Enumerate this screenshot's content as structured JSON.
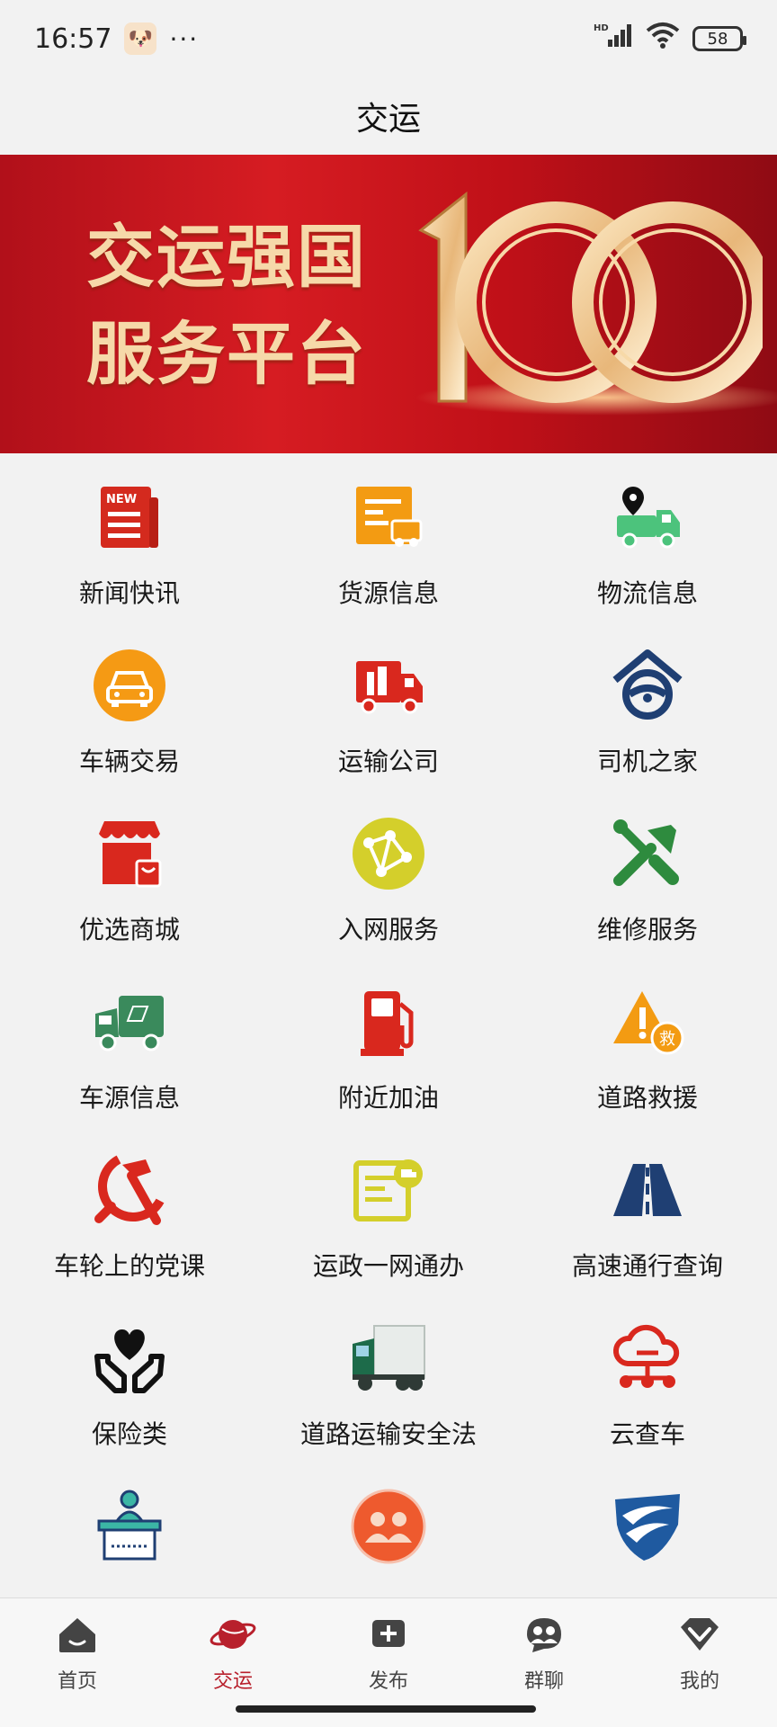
{
  "status": {
    "time": "16:57",
    "dots": "···",
    "network": "HD",
    "battery": "58"
  },
  "header": {
    "title": "交运"
  },
  "banner": {
    "title_line1": "交运强国",
    "title_line2": "服务平台",
    "number": "100"
  },
  "services": [
    {
      "label": "新闻快讯",
      "icon": "news-icon"
    },
    {
      "label": "货源信息",
      "icon": "cargo-source-icon"
    },
    {
      "label": "物流信息",
      "icon": "logistics-truck-icon"
    },
    {
      "label": "车辆交易",
      "icon": "car-trade-icon"
    },
    {
      "label": "运输公司",
      "icon": "transport-company-icon"
    },
    {
      "label": "司机之家",
      "icon": "driver-home-icon"
    },
    {
      "label": "优选商城",
      "icon": "store-icon"
    },
    {
      "label": "入网服务",
      "icon": "network-service-icon"
    },
    {
      "label": "维修服务",
      "icon": "repair-tools-icon"
    },
    {
      "label": "车源信息",
      "icon": "vehicle-source-icon"
    },
    {
      "label": "附近加油",
      "icon": "fuel-pump-icon"
    },
    {
      "label": "道路救援",
      "icon": "road-rescue-icon"
    },
    {
      "label": "车轮上的党课",
      "icon": "party-emblem-icon"
    },
    {
      "label": "运政一网通办",
      "icon": "gov-service-icon"
    },
    {
      "label": "高速通行查询",
      "icon": "highway-icon"
    },
    {
      "label": "保险类",
      "icon": "insurance-hands-icon"
    },
    {
      "label": "道路运输安全法",
      "icon": "truck-photo-icon"
    },
    {
      "label": "云查车",
      "icon": "cloud-check-icon"
    },
    {
      "label": "",
      "icon": "podium-icon"
    },
    {
      "label": "",
      "icon": "meeting-icon"
    },
    {
      "label": "",
      "icon": "shield-logo-icon"
    }
  ],
  "rescue_badge": "救",
  "tabs": [
    {
      "label": "首页",
      "icon": "home-icon"
    },
    {
      "label": "交运",
      "icon": "planet-icon"
    },
    {
      "label": "发布",
      "icon": "publish-icon"
    },
    {
      "label": "群聊",
      "icon": "group-chat-icon"
    },
    {
      "label": "我的",
      "icon": "profile-icon"
    }
  ],
  "colors": {
    "accent": "#b8202c",
    "banner_red": "#c8161d",
    "gold": "#f6d9a9"
  }
}
